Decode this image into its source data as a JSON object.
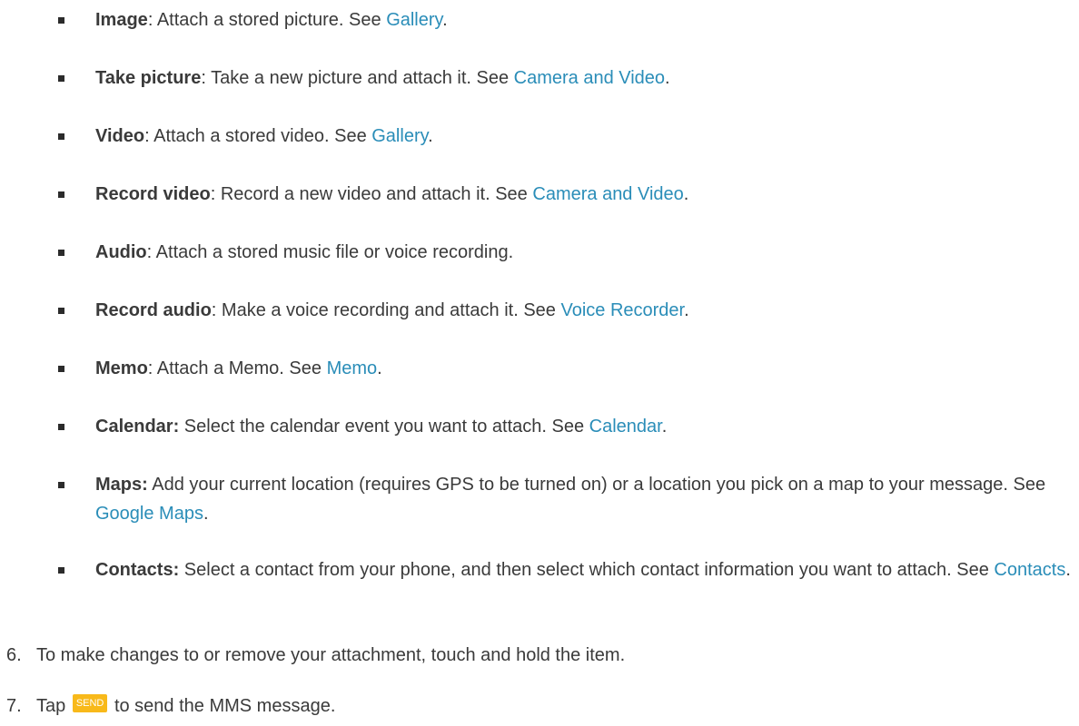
{
  "items": [
    {
      "term": "Image",
      "desc": ": Attach a stored picture. See ",
      "link": "Gallery",
      "end": "."
    },
    {
      "term": "Take picture",
      "desc": ": Take a new picture and attach it. See ",
      "link": "Camera and Video",
      "end": "."
    },
    {
      "term": "Video",
      "desc": ": Attach a stored video. See ",
      "link": "Gallery",
      "end": "."
    },
    {
      "term": "Record video",
      "desc": ": Record a new video and attach it. See ",
      "link": "Camera and Video",
      "end": "."
    },
    {
      "term": "Audio",
      "desc": ": Attach a stored music file or voice recording."
    },
    {
      "term": "Record audio",
      "desc": ": Make a voice recording and attach it. See ",
      "link": "Voice Recorder",
      "end": "."
    },
    {
      "term": "Memo",
      "desc": ": Attach a Memo. See ",
      "link": "Memo",
      "end": "."
    },
    {
      "term": "Calendar:",
      "desc": " Select the calendar event you want to attach. See ",
      "link": "Calendar",
      "end": "."
    },
    {
      "term": "Maps:",
      "desc": " Add your current location (requires GPS to be turned on) or a location you pick on a map to your message. See ",
      "link": "Google Maps",
      "end": "."
    },
    {
      "term": "Contacts:",
      "desc": " Select a contact from your phone, and then select which contact information you want to attach. See ",
      "link": "Contacts",
      "end": "."
    }
  ],
  "steps": [
    {
      "num": "6.",
      "text": "To make changes to or remove your attachment, touch and hold the item."
    },
    {
      "num": "7.",
      "before": "Tap",
      "badge": "SEND",
      "after": "to send the MMS message."
    }
  ]
}
